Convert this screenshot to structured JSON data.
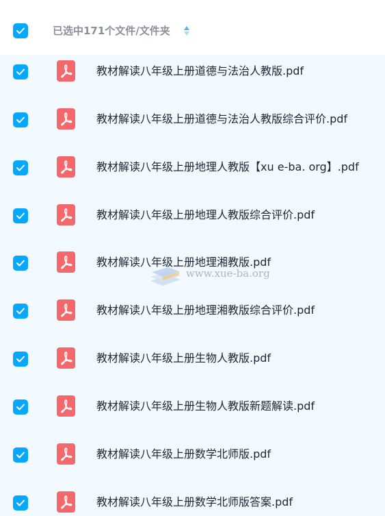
{
  "header": {
    "selection_label": "已选中171个文件/文件夹"
  },
  "files": [
    {
      "name": "教材解读八年级上册道德与法治人教版.pdf",
      "checked": true,
      "icon": "pdf-icon"
    },
    {
      "name": "教材解读八年级上册道德与法治人教版综合评价.pdf",
      "checked": true,
      "icon": "pdf-icon"
    },
    {
      "name": "教材解读八年级上册地理人教版【xu e-ba. org】.pdf",
      "checked": true,
      "icon": "pdf-icon"
    },
    {
      "name": "教材解读八年级上册地理人教版综合评价.pdf",
      "checked": true,
      "icon": "pdf-icon"
    },
    {
      "name": "教材解读八年级上册地理湘教版.pdf",
      "checked": true,
      "icon": "pdf-icon"
    },
    {
      "name": "教材解读八年级上册地理湘教版综合评价.pdf",
      "checked": true,
      "icon": "pdf-icon"
    },
    {
      "name": "教材解读八年级上册生物人教版.pdf",
      "checked": true,
      "icon": "pdf-icon"
    },
    {
      "name": "教材解读八年级上册生物人教版新题解读.pdf",
      "checked": true,
      "icon": "pdf-icon"
    },
    {
      "name": "教材解读八年级上册数学北师版.pdf",
      "checked": true,
      "icon": "pdf-icon"
    },
    {
      "name": "教材解读八年级上册数学北师版答案.pdf",
      "checked": true,
      "icon": "pdf-icon"
    }
  ],
  "watermark": {
    "text": "www.xue-ba.org"
  },
  "colors": {
    "checkbox": "#06a7ff",
    "pdf_icon": "#f4676a",
    "list_background": "#f2f9ff",
    "header_text": "#8a8f99",
    "file_text": "#1f2533"
  }
}
